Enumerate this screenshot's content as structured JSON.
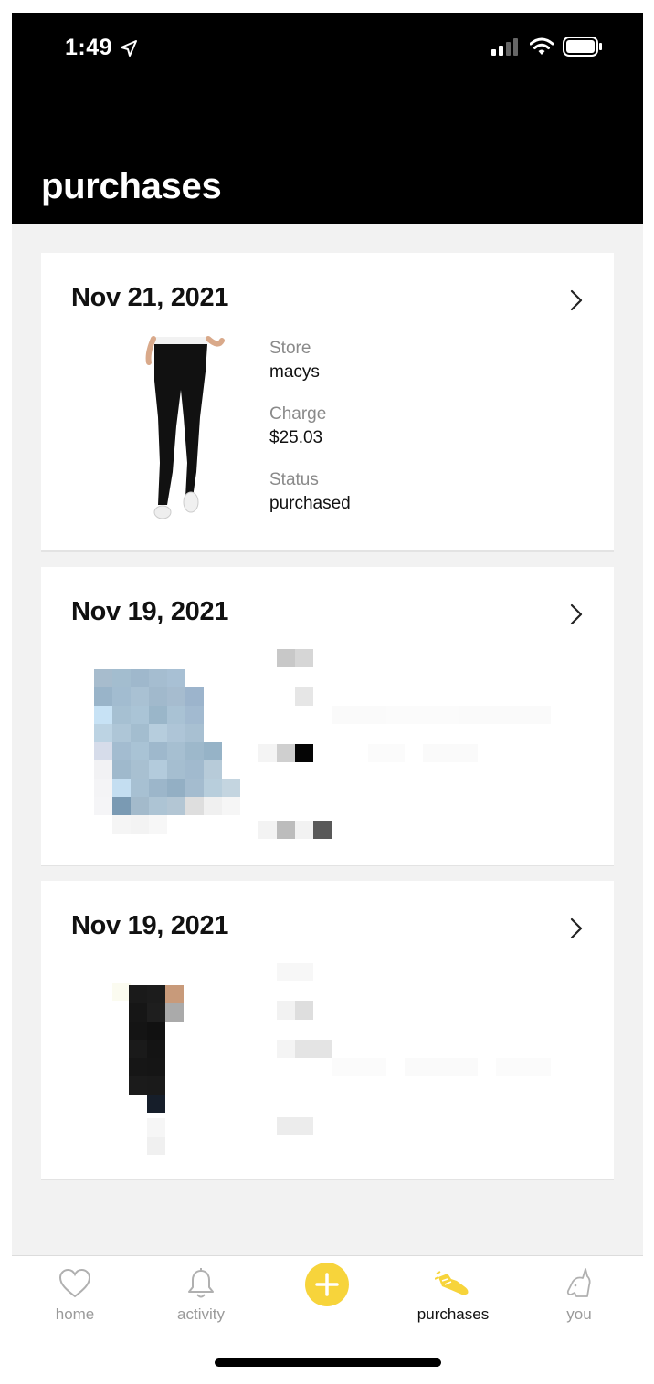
{
  "status_bar": {
    "time": "1:49"
  },
  "header": {
    "title": "purchases"
  },
  "cards": [
    {
      "date": "Nov 21, 2021",
      "store_label": "Store",
      "store": "macys",
      "charge_label": "Charge",
      "charge": "$25.03",
      "status_label": "Status",
      "status": "purchased"
    },
    {
      "date": "Nov 19, 2021"
    },
    {
      "date": "Nov 19, 2021"
    }
  ],
  "tabbar": {
    "items": [
      {
        "label": "home",
        "icon": "heart-icon"
      },
      {
        "label": "activity",
        "icon": "bell-icon"
      },
      {
        "label": "",
        "icon": "plus-icon"
      },
      {
        "label": "purchases",
        "icon": "sneaker-icon",
        "active": true
      },
      {
        "label": "you",
        "icon": "unicorn-icon"
      }
    ]
  },
  "colors": {
    "header_bg": "#000000",
    "accent_yellow": "#f7d43b",
    "page_bg": "#f2f2f2"
  }
}
